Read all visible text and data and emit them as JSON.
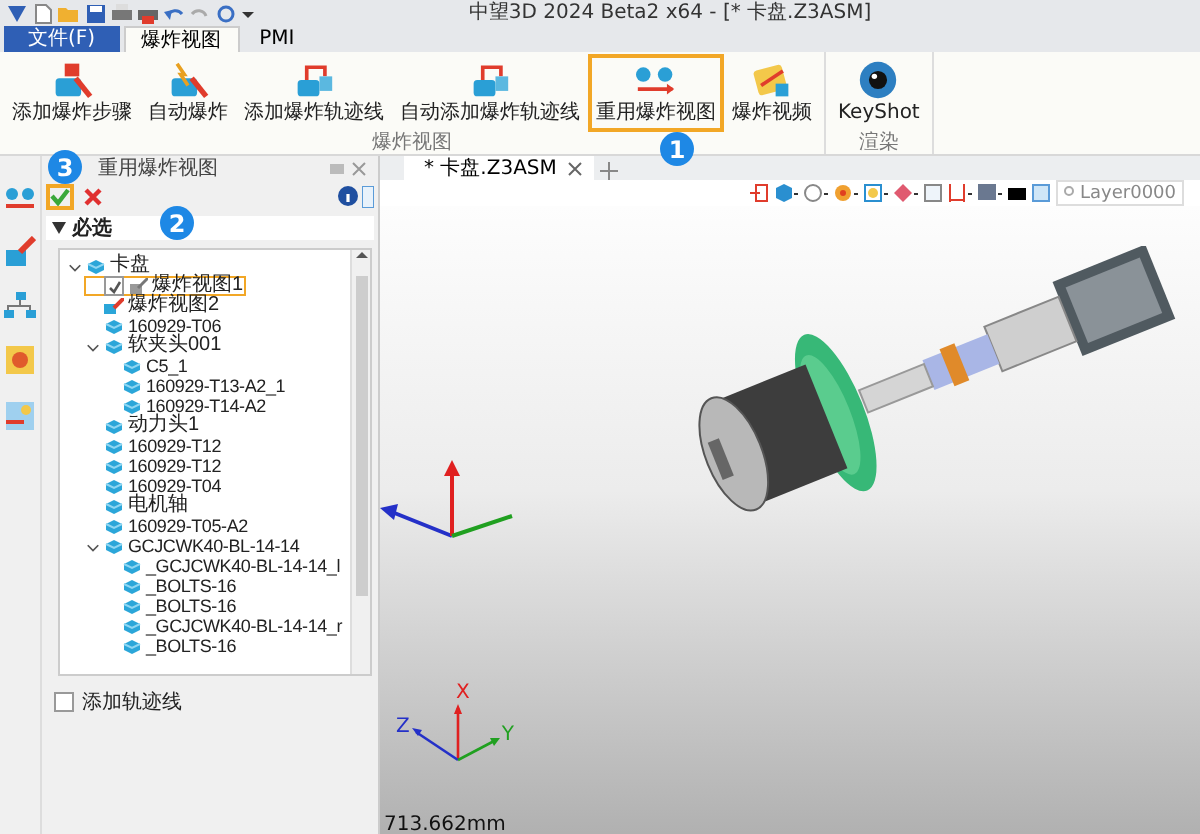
{
  "title_bar": {
    "title": "中望3D 2024 Beta2 x64 - [* 卡盘.Z3ASM]"
  },
  "menu_tabs": [
    {
      "label": "文件(F)",
      "kind": "file",
      "selected": false
    },
    {
      "label": "爆炸视图",
      "kind": "tab",
      "selected": true
    },
    {
      "label": "PMI",
      "kind": "tab",
      "selected": false
    }
  ],
  "ribbon_groups": [
    {
      "label": "爆炸视图",
      "buttons": [
        {
          "label": "添加爆炸步骤",
          "kind": "step",
          "highlighted": false
        },
        {
          "label": "自动爆炸",
          "kind": "auto",
          "highlighted": false
        },
        {
          "label": "添加爆炸轨迹线",
          "kind": "trail",
          "highlighted": false
        },
        {
          "label": "自动添加爆炸轨迹线",
          "kind": "trail",
          "highlighted": false
        },
        {
          "label": "重用爆炸视图",
          "kind": "reuse",
          "highlighted": true
        },
        {
          "label": "爆炸视频",
          "kind": "video",
          "highlighted": false
        }
      ]
    },
    {
      "label": "渲染",
      "buttons": [
        {
          "label": "KeyShot",
          "kind": "render",
          "highlighted": false
        }
      ]
    }
  ],
  "callouts": [
    "1",
    "2",
    "3"
  ],
  "panel": {
    "title": "重用爆炸视图",
    "actions": [
      {
        "kind": "ok",
        "highlighted": true
      },
      {
        "kind": "cancel",
        "highlighted": false
      }
    ],
    "section": "必选",
    "tree": [
      {
        "label": "卡盘",
        "kind": "part",
        "highlighted": false,
        "expanded": true,
        "children": [
          {
            "label": "爆炸视图1",
            "kind": "checked_view",
            "checked": true,
            "highlighted": true
          },
          {
            "label": "爆炸视图2",
            "kind": "view",
            "highlighted": false
          },
          {
            "label": "160929-T06",
            "kind": "part",
            "highlighted": false
          },
          {
            "label": "软夹头001",
            "kind": "part",
            "highlighted": false,
            "expanded": true,
            "children": [
              {
                "label": "C5_1",
                "kind": "part",
                "highlighted": false
              },
              {
                "label": "160929-T13-A2_1",
                "kind": "part",
                "highlighted": false
              },
              {
                "label": "160929-T14-A2",
                "kind": "part",
                "highlighted": false
              }
            ]
          },
          {
            "label": "动力头1",
            "kind": "part",
            "highlighted": false
          },
          {
            "label": "160929-T12",
            "kind": "part",
            "highlighted": false
          },
          {
            "label": "160929-T12",
            "kind": "part",
            "highlighted": false
          },
          {
            "label": "160929-T04",
            "kind": "part",
            "highlighted": false
          },
          {
            "label": "电机轴",
            "kind": "part",
            "highlighted": false
          },
          {
            "label": "160929-T05-A2",
            "kind": "part",
            "highlighted": false
          },
          {
            "label": "GCJCWK40-BL-14-14",
            "kind": "part",
            "highlighted": false,
            "expanded": true,
            "children": [
              {
                "label": "_GCJCWK40-BL-14-14_l",
                "kind": "part",
                "highlighted": false
              },
              {
                "label": "_BOLTS-16",
                "kind": "part",
                "highlighted": false
              },
              {
                "label": "_BOLTS-16",
                "kind": "part",
                "highlighted": false
              },
              {
                "label": "_GCJCWK40-BL-14-14_r",
                "kind": "part",
                "highlighted": false
              },
              {
                "label": "_BOLTS-16",
                "kind": "part",
                "highlighted": false
              }
            ]
          }
        ]
      }
    ],
    "option": {
      "label": "添加轨迹线",
      "checked": false
    }
  },
  "document_tab": {
    "label": "* 卡盘.Z3ASM"
  },
  "layer_field": {
    "value": "Layer0000"
  },
  "axes": [
    {
      "label": "X"
    },
    {
      "label": "Y"
    },
    {
      "label": "Z"
    }
  ],
  "distance": "713.662mm"
}
